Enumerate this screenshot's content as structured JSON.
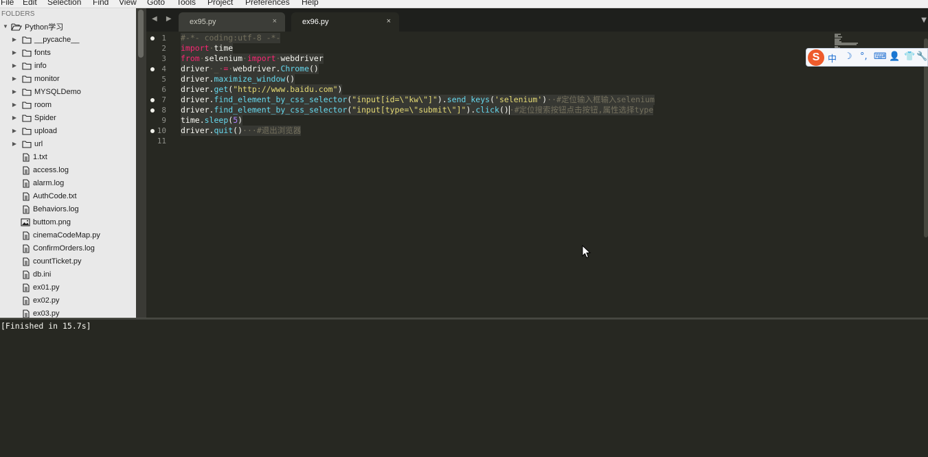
{
  "menu": [
    "File",
    "Edit",
    "Selection",
    "Find",
    "View",
    "Goto",
    "Tools",
    "Project",
    "Preferences",
    "Help"
  ],
  "sidebar": {
    "header": "FOLDERS",
    "root": "Python学习",
    "items": [
      {
        "label": "__pycache__",
        "type": "folder"
      },
      {
        "label": "fonts",
        "type": "folder"
      },
      {
        "label": "info",
        "type": "folder"
      },
      {
        "label": "monitor",
        "type": "folder"
      },
      {
        "label": "MYSQLDemo",
        "type": "folder"
      },
      {
        "label": "room",
        "type": "folder"
      },
      {
        "label": "Spider",
        "type": "folder"
      },
      {
        "label": "upload",
        "type": "folder"
      },
      {
        "label": "url",
        "type": "folder"
      },
      {
        "label": "1.txt",
        "type": "file"
      },
      {
        "label": "access.log",
        "type": "file"
      },
      {
        "label": "alarm.log",
        "type": "file"
      },
      {
        "label": "AuthCode.txt",
        "type": "file"
      },
      {
        "label": "Behaviors.log",
        "type": "file"
      },
      {
        "label": "buttom.png",
        "type": "image"
      },
      {
        "label": "cinemaCodeMap.py",
        "type": "file"
      },
      {
        "label": "ConfirmOrders.log",
        "type": "file"
      },
      {
        "label": "countTicket.py",
        "type": "file"
      },
      {
        "label": "db.ini",
        "type": "file"
      },
      {
        "label": "ex01.py",
        "type": "file"
      },
      {
        "label": "ex02.py",
        "type": "file"
      },
      {
        "label": "ex03.py",
        "type": "file"
      }
    ]
  },
  "tabs": [
    {
      "label": "ex95.py",
      "close": "×",
      "active": false
    },
    {
      "label": "ex96.py",
      "close": "×",
      "active": true
    }
  ],
  "nav_arrows": "◀ ▶",
  "tab_dropdown": "▼",
  "editor": {
    "line_numbers": [
      "1",
      "2",
      "3",
      "4",
      "5",
      "6",
      "7",
      "8",
      "9",
      "10",
      "11"
    ],
    "modified_lines": [
      1,
      4,
      7,
      8,
      10
    ],
    "lines": [
      [
        {
          "t": "#-*- coding:utf-8 -*-",
          "c": "cm"
        }
      ],
      [
        {
          "t": "import",
          "c": "kw"
        },
        {
          "t": "·",
          "c": "ws"
        },
        {
          "t": "time",
          "c": "id"
        }
      ],
      [
        {
          "t": "from",
          "c": "kw"
        },
        {
          "t": "·",
          "c": "ws"
        },
        {
          "t": "selenium",
          "c": "id"
        },
        {
          "t": "·",
          "c": "ws"
        },
        {
          "t": "import",
          "c": "kw"
        },
        {
          "t": "·",
          "c": "ws"
        },
        {
          "t": "webdriver",
          "c": "id"
        }
      ],
      [
        {
          "t": "driver",
          "c": "id"
        },
        {
          "t": "·_·",
          "c": "ws"
        },
        {
          "t": "=",
          "c": "kw"
        },
        {
          "t": "·",
          "c": "ws"
        },
        {
          "t": "webdriver.",
          "c": "id"
        },
        {
          "t": "Chrome",
          "c": "fn"
        },
        {
          "t": "()",
          "c": "id"
        }
      ],
      [
        {
          "t": "driver.",
          "c": "id"
        },
        {
          "t": "maximize_window",
          "c": "fn"
        },
        {
          "t": "()",
          "c": "id"
        }
      ],
      [
        {
          "t": "driver.",
          "c": "id"
        },
        {
          "t": "get",
          "c": "fn"
        },
        {
          "t": "(",
          "c": "id"
        },
        {
          "t": "\"http://www.baidu.com\"",
          "c": "str"
        },
        {
          "t": ")",
          "c": "id"
        }
      ],
      [
        {
          "t": "driver.",
          "c": "id"
        },
        {
          "t": "find_element_by_css_selector",
          "c": "fn"
        },
        {
          "t": "(",
          "c": "id"
        },
        {
          "t": "\"input[id=\\\"kw\\\"]\"",
          "c": "str"
        },
        {
          "t": ").",
          "c": "id"
        },
        {
          "t": "send_keys",
          "c": "fn"
        },
        {
          "t": "(",
          "c": "id"
        },
        {
          "t": "'selenium'",
          "c": "str"
        },
        {
          "t": ")",
          "c": "id"
        },
        {
          "t": "··",
          "c": "ws"
        },
        {
          "t": "#定位输入框输入selenium",
          "c": "cm"
        }
      ],
      [
        {
          "t": "driver.",
          "c": "id"
        },
        {
          "t": "find_element_by_css_selector",
          "c": "fn"
        },
        {
          "t": "(",
          "c": "id"
        },
        {
          "t": "\"input[type=\\\"submit\\\"]\"",
          "c": "str"
        },
        {
          "t": ").",
          "c": "id"
        },
        {
          "t": "click",
          "c": "fn"
        },
        {
          "t": "()",
          "c": "id"
        },
        {
          "t": "caret",
          "c": "caret"
        },
        {
          "t": "·",
          "c": "ws"
        },
        {
          "t": "#定位搜索按钮点击按钮,属性选择type",
          "c": "cm"
        }
      ],
      [
        {
          "t": "time.",
          "c": "id"
        },
        {
          "t": "sleep",
          "c": "fn"
        },
        {
          "t": "(",
          "c": "id"
        },
        {
          "t": "5",
          "c": "num"
        },
        {
          "t": ")",
          "c": "id"
        }
      ],
      [
        {
          "t": "driver.",
          "c": "id"
        },
        {
          "t": "quit",
          "c": "fn"
        },
        {
          "t": "()",
          "c": "id"
        },
        {
          "t": "···",
          "c": "ws"
        },
        {
          "t": "#退出浏览器",
          "c": "cm"
        }
      ],
      []
    ]
  },
  "ime_toolbar": {
    "logo": "S",
    "items": [
      "中",
      "☽",
      "°,",
      "⌨",
      "👤",
      "👕",
      "🔧"
    ]
  },
  "output": {
    "text": "[Finished in 15.7s]"
  }
}
